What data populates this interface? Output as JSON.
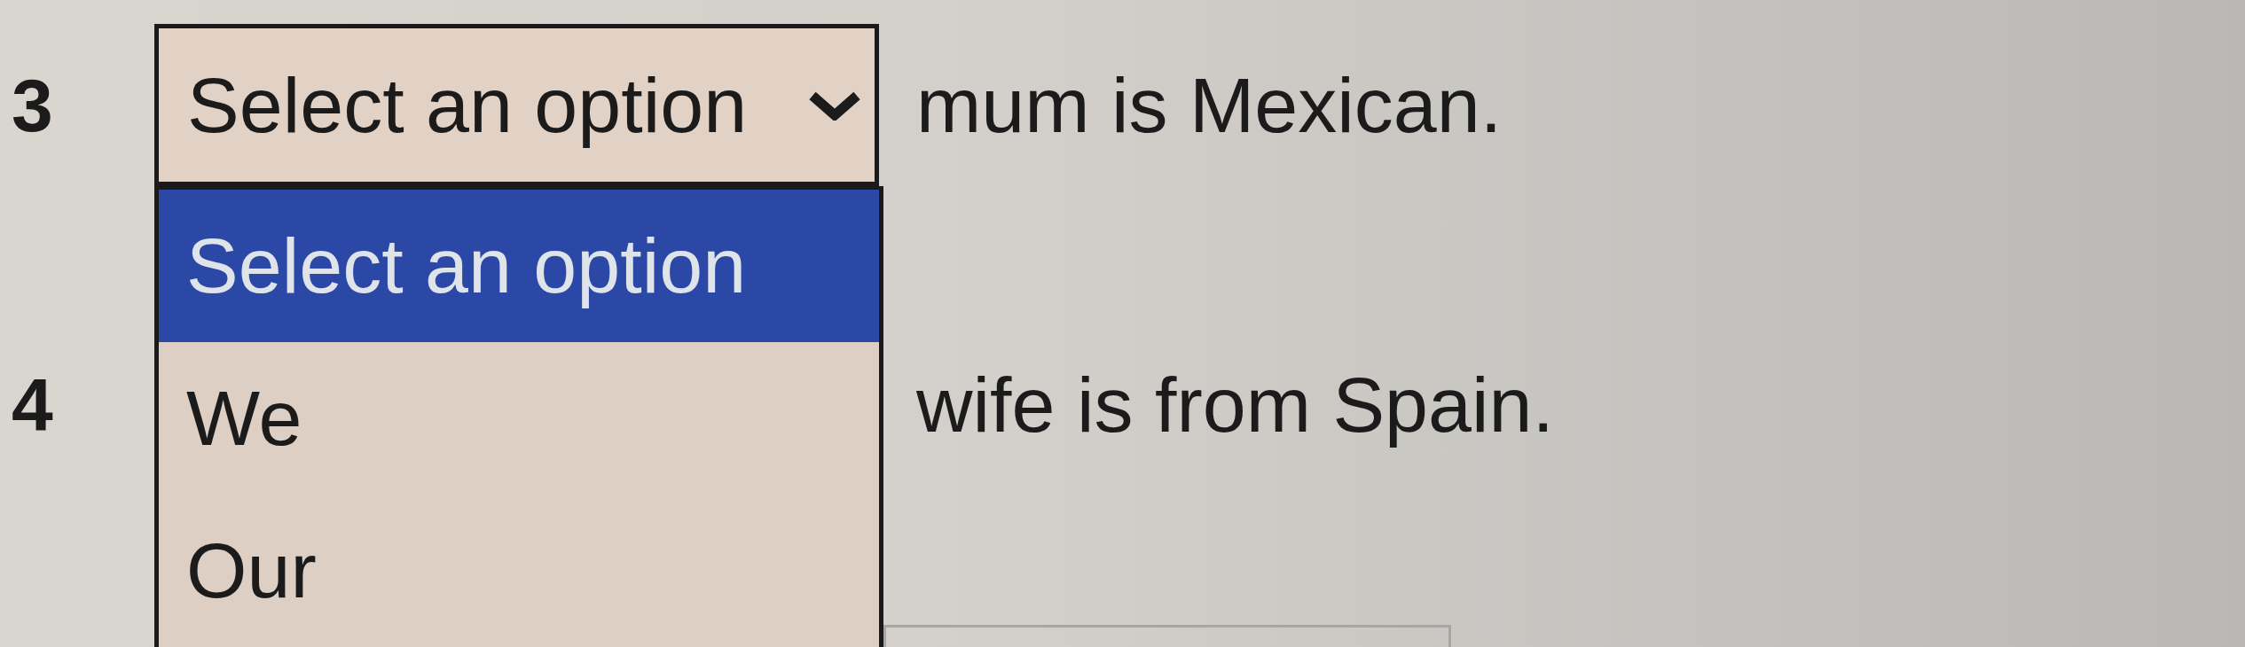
{
  "questions": [
    {
      "number": "3",
      "select": {
        "value": "Select an option",
        "expanded": true,
        "options": [
          {
            "label": "Select an option",
            "selected": true
          },
          {
            "label": "We",
            "selected": false
          },
          {
            "label": "Our",
            "selected": false
          }
        ]
      },
      "text": "mum is Mexican."
    },
    {
      "number": "4",
      "text": "wife is from Spain."
    }
  ]
}
